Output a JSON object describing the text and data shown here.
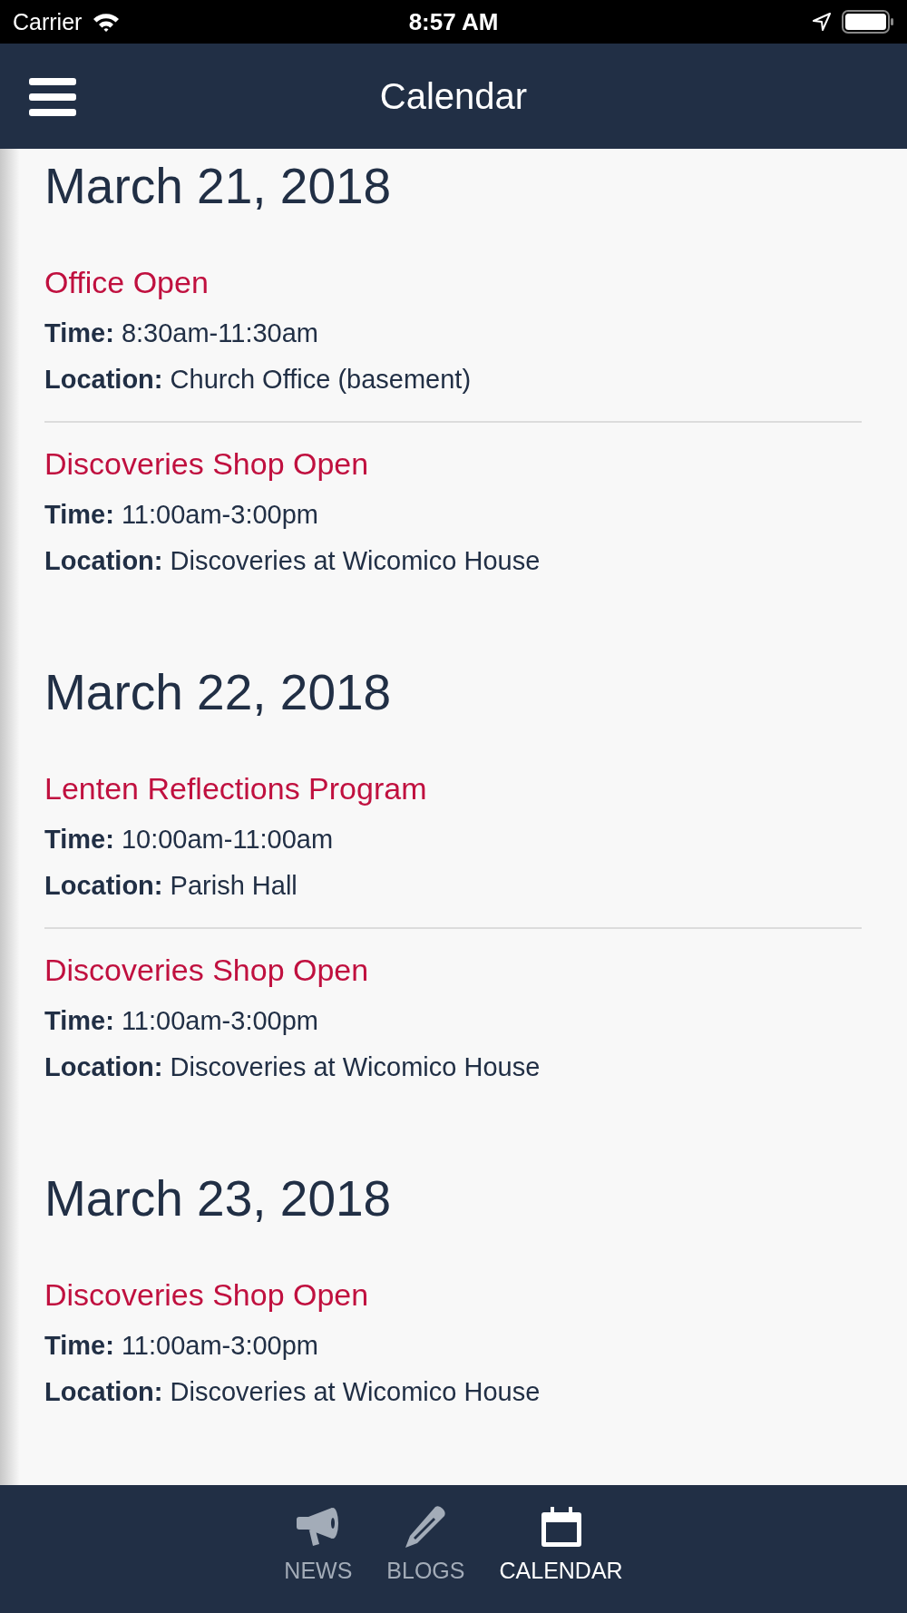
{
  "status_bar": {
    "carrier": "Carrier",
    "time": "8:57 AM"
  },
  "nav_bar": {
    "title": "Calendar"
  },
  "days": [
    {
      "date": "March 21, 2018",
      "events": [
        {
          "title": "Office Open",
          "time": "**Time:** 8:30am-11:30am",
          "location": "**Location:** Church Office (basement)"
        },
        {
          "title": "Discoveries Shop Open",
          "time": "**Time:** 11:00am-3:00pm",
          "location": "**Location:** Discoveries at Wicomico House"
        }
      ]
    },
    {
      "date": "March 22, 2018",
      "events": [
        {
          "title": "Lenten Reflections Program",
          "time": "**Time:** 10:00am-11:00am",
          "location": "**Location:** Parish Hall"
        },
        {
          "title": "Discoveries Shop Open",
          "time": "**Time:** 11:00am-3:00pm",
          "location": "**Location:** Discoveries at Wicomico House"
        }
      ]
    },
    {
      "date": "March 23, 2018",
      "events": [
        {
          "title": "Discoveries Shop Open",
          "time": "**Time:** 11:00am-3:00pm",
          "location": "**Location:** Discoveries at Wicomico House"
        }
      ]
    }
  ],
  "tab_bar": [
    {
      "kind": "megaphone",
      "label": "NEWS",
      "selected": false
    },
    {
      "kind": "pencil",
      "label": "BLOGS",
      "selected": false
    },
    {
      "kind": "calendar",
      "label": "CALENDAR",
      "selected": true
    }
  ]
}
